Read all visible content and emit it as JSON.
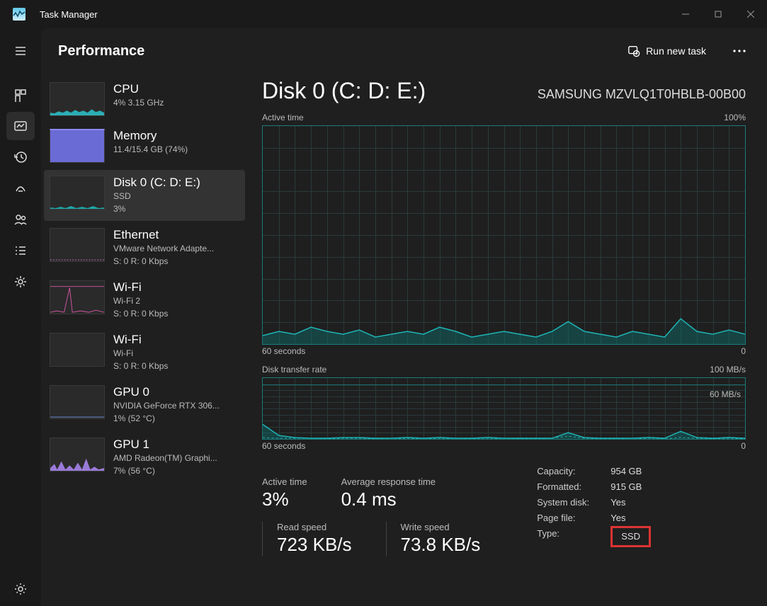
{
  "app": {
    "title": "Task Manager"
  },
  "page": {
    "title": "Performance",
    "run_task": "Run new task"
  },
  "sidebar": {
    "items": [
      {
        "title": "CPU",
        "sub1": "4%  3.15 GHz",
        "sub2": ""
      },
      {
        "title": "Memory",
        "sub1": "11.4/15.4 GB (74%)",
        "sub2": ""
      },
      {
        "title": "Disk 0 (C: D: E:)",
        "sub1": "SSD",
        "sub2": "3%"
      },
      {
        "title": "Ethernet",
        "sub1": "VMware Network Adapte...",
        "sub2": "S: 0  R: 0 Kbps"
      },
      {
        "title": "Wi-Fi",
        "sub1": "Wi-Fi 2",
        "sub2": "S: 0  R: 0 Kbps"
      },
      {
        "title": "Wi-Fi",
        "sub1": "Wi-Fi",
        "sub2": "S: 0  R: 0 Kbps"
      },
      {
        "title": "GPU 0",
        "sub1": "NVIDIA GeForce RTX 306...",
        "sub2": "1%  (52 °C)"
      },
      {
        "title": "GPU 1",
        "sub1": "AMD Radeon(TM) Graphi...",
        "sub2": "7%  (56 °C)"
      }
    ]
  },
  "detail": {
    "title": "Disk 0 (C: D: E:)",
    "device": "SAMSUNG MZVLQ1T0HBLB-00B00",
    "chart1": {
      "label": "Active time",
      "max": "100%",
      "xleft": "60 seconds",
      "xright": "0"
    },
    "chart2": {
      "label": "Disk transfer rate",
      "max": "100 MB/s",
      "inner": "60 MB/s",
      "xleft": "60 seconds",
      "xright": "0"
    },
    "stats": {
      "active_time_label": "Active time",
      "active_time_value": "3%",
      "avg_resp_label": "Average response time",
      "avg_resp_value": "0.4 ms",
      "read_label": "Read speed",
      "read_value": "723 KB/s",
      "write_label": "Write speed",
      "write_value": "73.8 KB/s"
    },
    "info": {
      "capacity_k": "Capacity:",
      "capacity_v": "954 GB",
      "formatted_k": "Formatted:",
      "formatted_v": "915 GB",
      "sysdisk_k": "System disk:",
      "sysdisk_v": "Yes",
      "pagefile_k": "Page file:",
      "pagefile_v": "Yes",
      "type_k": "Type:",
      "type_v": "SSD"
    }
  },
  "chart_data": [
    {
      "type": "area",
      "title": "Active time",
      "ylabel": "Active time %",
      "ylim": [
        0,
        100
      ],
      "xlabel": "seconds",
      "xlim": [
        60,
        0
      ],
      "x": [
        60,
        58,
        56,
        54,
        52,
        50,
        48,
        46,
        44,
        42,
        40,
        38,
        36,
        34,
        32,
        30,
        28,
        26,
        24,
        22,
        20,
        18,
        16,
        14,
        12,
        10,
        8,
        6,
        4,
        2,
        0
      ],
      "values": [
        4,
        6,
        5,
        8,
        6,
        5,
        7,
        4,
        5,
        6,
        5,
        8,
        6,
        4,
        5,
        6,
        5,
        4,
        6,
        10,
        6,
        5,
        4,
        6,
        5,
        4,
        12,
        6,
        5,
        7,
        5
      ]
    },
    {
      "type": "area",
      "title": "Disk transfer rate",
      "ylabel": "MB/s",
      "ylim": [
        0,
        100
      ],
      "inner_marker": 60,
      "xlabel": "seconds",
      "xlim": [
        60,
        0
      ],
      "series": [
        {
          "name": "Read",
          "values": [
            24,
            6,
            2,
            1,
            1,
            2,
            2,
            1,
            1,
            2,
            1,
            2,
            1,
            1,
            2,
            1,
            1,
            1,
            1,
            10,
            2,
            1,
            1,
            1,
            2,
            1,
            12,
            2,
            1,
            2,
            1
          ]
        },
        {
          "name": "Write",
          "values": [
            2,
            1,
            1,
            1,
            0,
            1,
            1,
            0,
            1,
            0,
            1,
            0,
            1,
            0,
            0,
            1,
            0,
            0,
            1,
            4,
            1,
            0,
            0,
            1,
            0,
            0,
            2,
            1,
            0,
            1,
            0
          ]
        }
      ],
      "x": [
        60,
        58,
        56,
        54,
        52,
        50,
        48,
        46,
        44,
        42,
        40,
        38,
        36,
        34,
        32,
        30,
        28,
        26,
        24,
        22,
        20,
        18,
        16,
        14,
        12,
        10,
        8,
        6,
        4,
        2,
        0
      ]
    }
  ]
}
